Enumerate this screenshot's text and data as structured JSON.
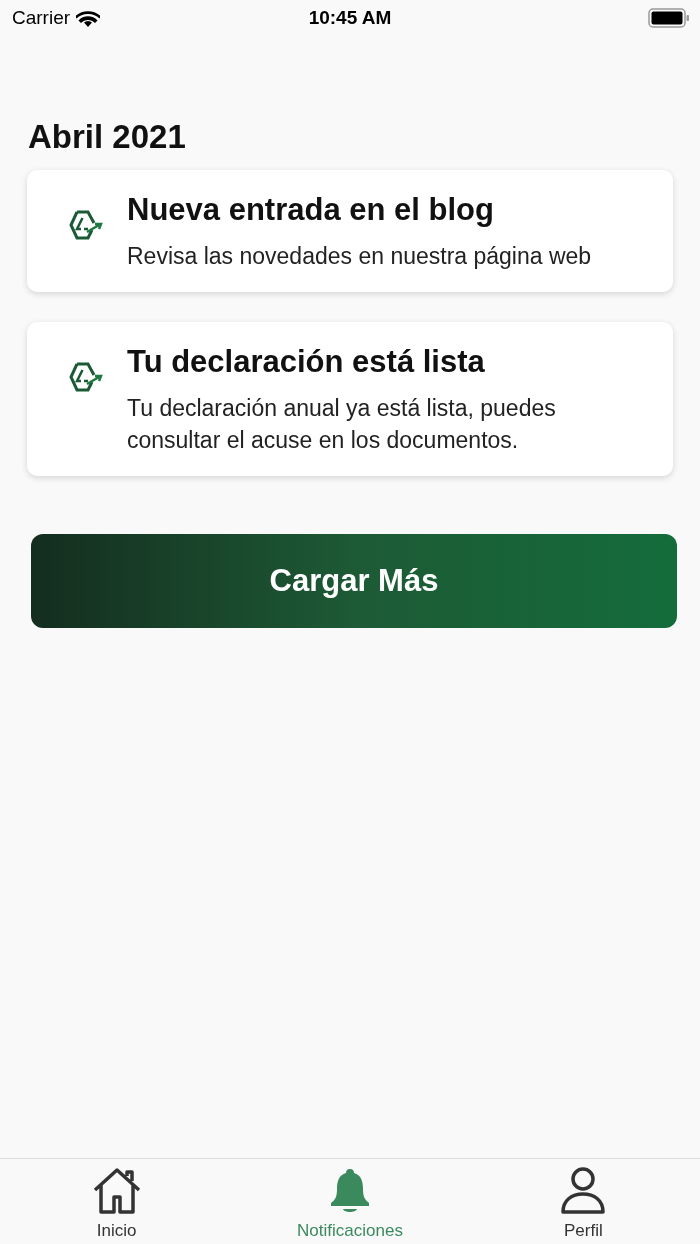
{
  "status_bar": {
    "carrier": "Carrier",
    "time": "10:45 AM"
  },
  "section_title": "Abril 2021",
  "notifications": [
    {
      "title": "Nueva entrada en el blog",
      "body": "Revisa las novedades en nuestra página web"
    },
    {
      "title": "Tu declaración está lista",
      "body": "Tu declaración anual ya está lista, puedes consultar el acuse en los documentos."
    }
  ],
  "load_more_button": "Cargar Más",
  "tab_bar": [
    {
      "kind": "home",
      "label": "Inicio",
      "selected": false
    },
    {
      "kind": "bell",
      "label": "Notificaciones",
      "selected": true
    },
    {
      "kind": "person",
      "label": "Perfil",
      "selected": false
    }
  ]
}
